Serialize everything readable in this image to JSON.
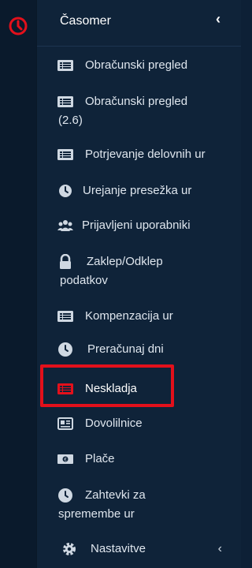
{
  "sidebar": {
    "title": "Časomer",
    "items": [
      {
        "label": "Obračunski pregled",
        "icon": "list-card-icon"
      },
      {
        "label_line1": "Obračunski pregled",
        "label_line2": "(2.6)",
        "icon": "list-card-icon"
      },
      {
        "label": "Potrjevanje delovnih ur",
        "icon": "list-card-icon"
      },
      {
        "label": "Urejanje presežka ur",
        "icon": "clock-icon"
      },
      {
        "label": "Prijavljeni uporabniki",
        "icon": "users-icon"
      },
      {
        "label_line1": "Zaklep/Odklep",
        "label_line2": "podatkov",
        "icon": "lock-icon"
      },
      {
        "label": "Kompenzacija ur",
        "icon": "list-card-icon"
      },
      {
        "label": "Preračunaj dni",
        "icon": "clock-icon"
      },
      {
        "label": "Neskladja",
        "icon": "list-card-icon",
        "active": true
      },
      {
        "label": "Dovolilnice",
        "icon": "newspaper-icon"
      },
      {
        "label": "Plače",
        "icon": "money-icon"
      },
      {
        "label_line1": "Zahtevki za",
        "label_line2": "spremembe ur",
        "icon": "clock-icon"
      },
      {
        "label": "Nastavitve",
        "icon": "gear-icon"
      }
    ]
  },
  "colors": {
    "accent_red": "#e3101b",
    "background": "#0f2339"
  }
}
